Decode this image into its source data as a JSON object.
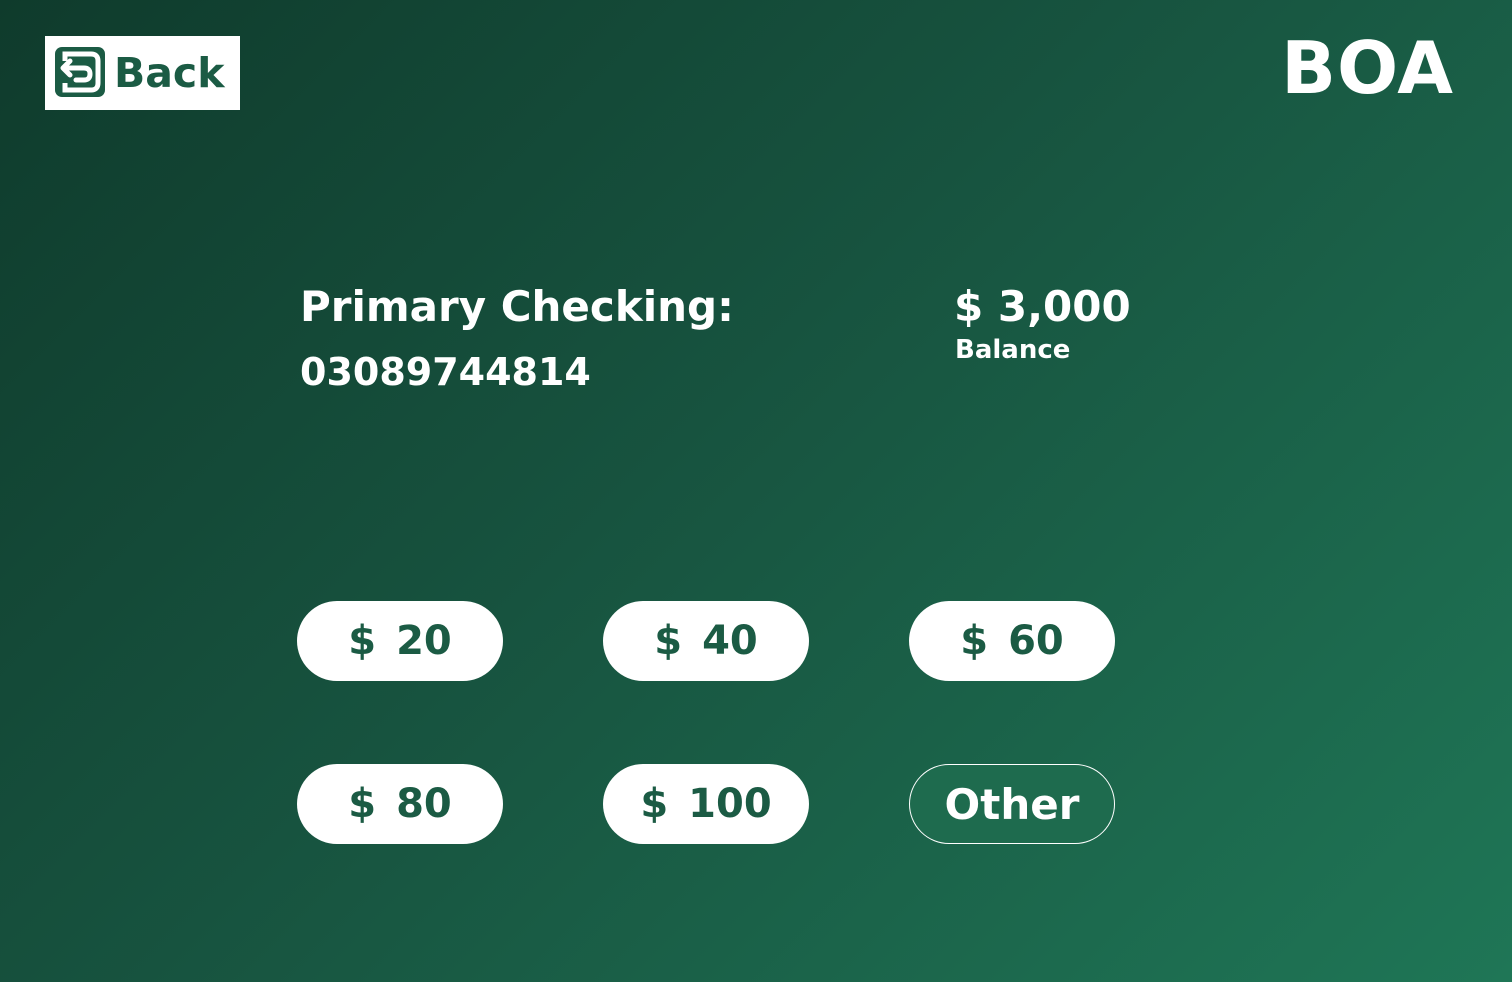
{
  "header": {
    "back_label": "Back",
    "back_icon": "logout-arrow-icon",
    "brand": "BOA"
  },
  "account": {
    "name": "Primary Checking:",
    "number": "03089744814",
    "balance_amount": "$ 3,000",
    "balance_label": "Balance"
  },
  "amounts": [
    {
      "currency": "$",
      "value": "20"
    },
    {
      "currency": "$",
      "value": "40"
    },
    {
      "currency": "$",
      "value": "60"
    },
    {
      "currency": "$",
      "value": "80"
    },
    {
      "currency": "$",
      "value": "100"
    }
  ],
  "other_label": "Other",
  "colors": {
    "background_start": "#0f3b2c",
    "background_end": "#1f7656",
    "accent": "#1b5b44",
    "text": "#ffffff"
  }
}
